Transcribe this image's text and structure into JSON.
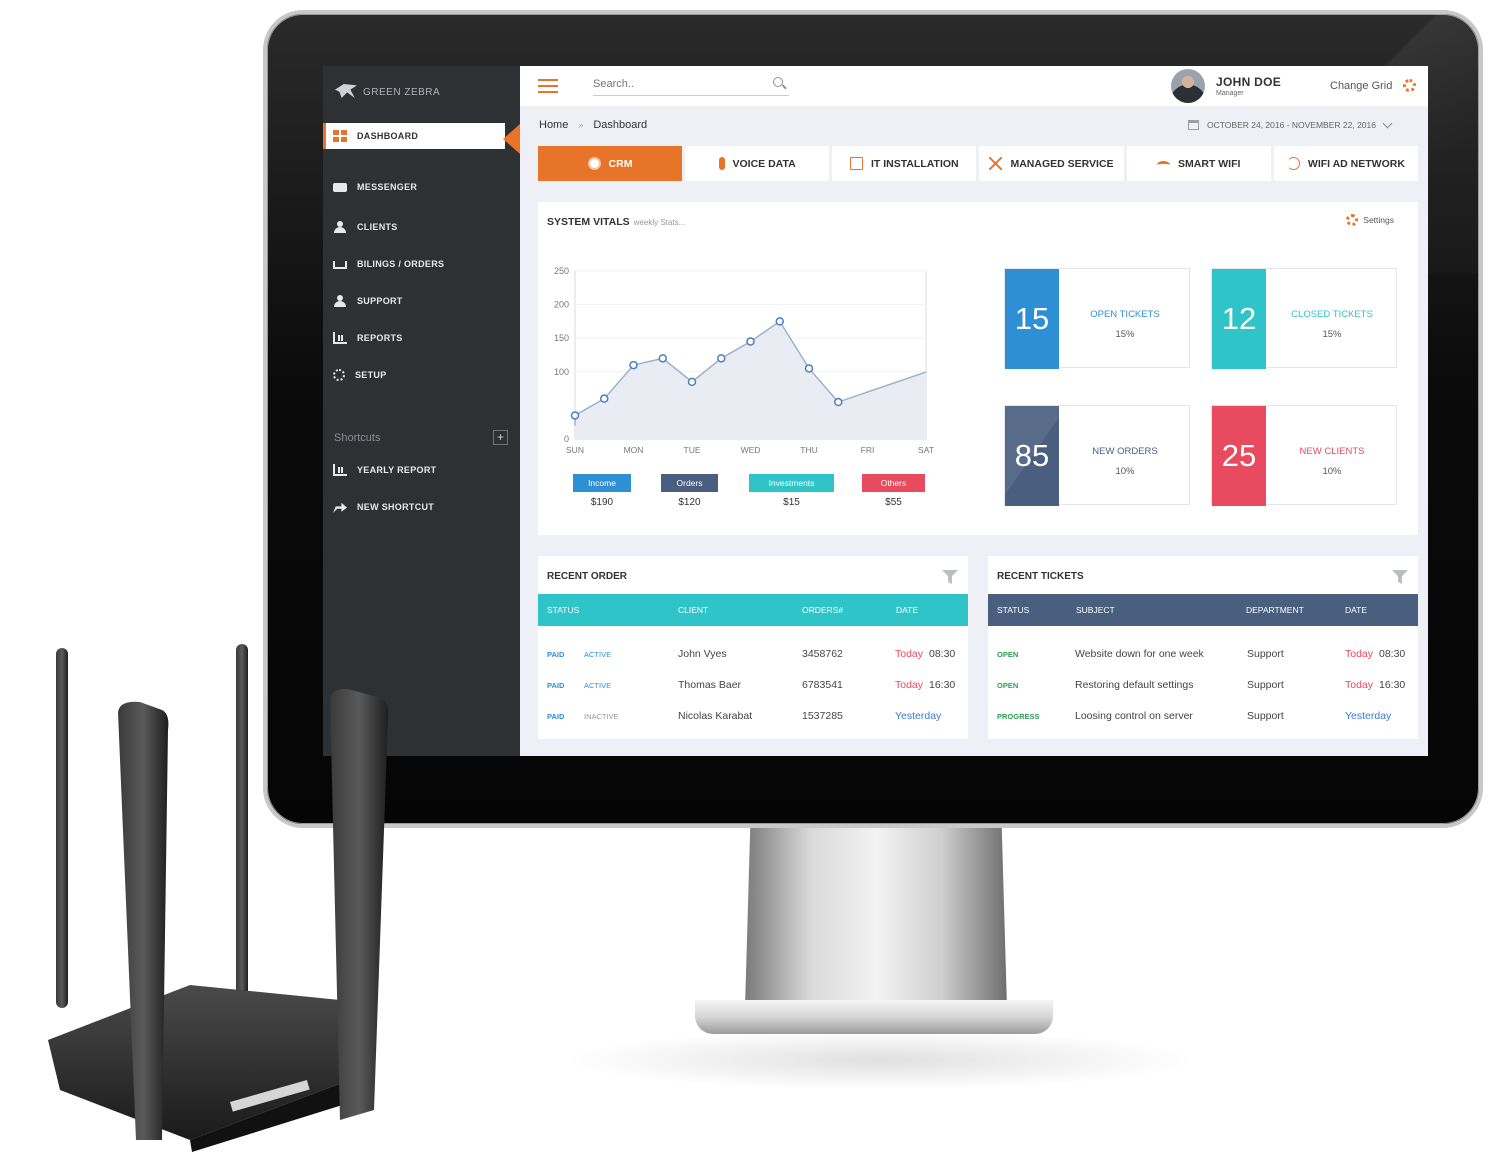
{
  "app": {
    "brand": "GREEN ZEBRA",
    "accent": "#e8742a",
    "sidebar_bg": "#2e3133"
  },
  "sidebar": {
    "items": [
      {
        "label": "DASHBOARD",
        "icon": "dashboard-icon",
        "active": true
      },
      {
        "label": "MESSENGER",
        "icon": "chat-icon"
      },
      {
        "label": "CLIENTS",
        "icon": "user-icon"
      },
      {
        "label": "BILINGS / ORDERS",
        "icon": "cart-icon"
      },
      {
        "label": "SUPPORT",
        "icon": "support-icon"
      },
      {
        "label": "REPORTS",
        "icon": "chart-icon"
      },
      {
        "label": "SETUP",
        "icon": "gear-icon"
      }
    ],
    "shortcuts_label": "Shortcuts",
    "shortcuts_add": "+",
    "shortcuts": [
      {
        "label": "YEARLY REPORT",
        "icon": "chart-icon"
      },
      {
        "label": "NEW SHORTCUT",
        "icon": "share-icon"
      }
    ]
  },
  "topbar": {
    "search_placeholder": "Search..",
    "user_name": "JOHN DOE",
    "user_role": "Manager",
    "change_grid": "Change Grid"
  },
  "breadcrumb": {
    "home": "Home",
    "sep": "»",
    "current": "Dashboard"
  },
  "date_range": "OCTOBER 24, 2016 - NOVEMBER 22, 2016",
  "tabs": [
    {
      "label": "CRM",
      "icon": "wordpress-icon",
      "active": true
    },
    {
      "label": "VOICE DATA",
      "icon": "microphone-icon"
    },
    {
      "label": "IT INSTALLATION",
      "icon": "document-icon"
    },
    {
      "label": "MANAGED SERVICE",
      "icon": "tools-icon"
    },
    {
      "label": "SMART WIFI",
      "icon": "wifi-icon"
    },
    {
      "label": "WIFI AD NETWORK",
      "icon": "ad-network-icon"
    }
  ],
  "vitals": {
    "title": "SYSTEM VITALS",
    "subtitle": "weekly Stats...",
    "settings_label": "Settings",
    "legend": [
      {
        "label": "Income",
        "value": "$190",
        "color": "#2f8fd4"
      },
      {
        "label": "Orders",
        "value": "$120",
        "color": "#4a5f7f"
      },
      {
        "label": "Investments",
        "value": "$15",
        "color": "#2ec4c8"
      },
      {
        "label": "Others",
        "value": "$55",
        "color": "#e84a5f"
      }
    ],
    "stats": [
      {
        "number": "15",
        "label": "OPEN TICKETS",
        "pct": "15%",
        "color": "#2f8fd4",
        "label_color": "#2f8fd4"
      },
      {
        "number": "12",
        "label": "CLOSED TICKETS",
        "pct": "15%",
        "color": "#2ec4c8",
        "label_color": "#2ec4c8"
      },
      {
        "number": "85",
        "label": "NEW ORDERS",
        "pct": "10%",
        "color": "#4a5f7f",
        "label_color": "#4a5f7f"
      },
      {
        "number": "25",
        "label": "NEW CLIENTS",
        "pct": "10%",
        "color": "#e84a5f",
        "label_color": "#e84a5f"
      }
    ]
  },
  "chart_data": {
    "type": "area",
    "categories": [
      "SUN",
      "MON",
      "TUE",
      "WED",
      "THU",
      "FRI",
      "SAT"
    ],
    "x": [
      0,
      0.5,
      1,
      1.5,
      2,
      2.5,
      3,
      3.5,
      4,
      4.5,
      5,
      5.5,
      6
    ],
    "values": [
      35,
      60,
      110,
      120,
      85,
      120,
      145,
      175,
      105,
      55
    ],
    "ylim": [
      0,
      250
    ],
    "yticks": [
      0,
      100,
      150,
      200,
      250
    ],
    "grid": true
  },
  "recent_order": {
    "title": "RECENT ORDER",
    "columns": [
      "STATUS",
      "CLIENT",
      "ORDERS#",
      "DATE"
    ],
    "header_color": "#2ec4c8",
    "rows": [
      {
        "status1": "PAID",
        "status2": "ACTIVE",
        "client": "John Vyes",
        "order": "3458762",
        "day": "Today",
        "time": "08:30"
      },
      {
        "status1": "PAID",
        "status2": "ACTIVE",
        "client": "Thomas Baer",
        "order": "6783541",
        "day": "Today",
        "time": "16:30"
      },
      {
        "status1": "PAID",
        "status2": "INACTIVE",
        "client": "Nicolas Karabat",
        "order": "1537285",
        "day": "Yesterday",
        "time": ""
      }
    ]
  },
  "recent_tickets": {
    "title": "RECENT TICKETS",
    "columns": [
      "STATUS",
      "SUBJECT",
      "DEPARTMENT",
      "DATE"
    ],
    "header_color": "#4a5f7f",
    "rows": [
      {
        "status": "OPEN",
        "subject": "Website down for one week",
        "department": "Support",
        "day": "Today",
        "time": "08:30"
      },
      {
        "status": "OPEN",
        "subject": "Restoring default settings",
        "department": "Support",
        "day": "Today",
        "time": "16:30"
      },
      {
        "status": "PROGRESS",
        "subject": "Loosing control on server",
        "department": "Support",
        "day": "Yesterday",
        "time": ""
      }
    ]
  }
}
